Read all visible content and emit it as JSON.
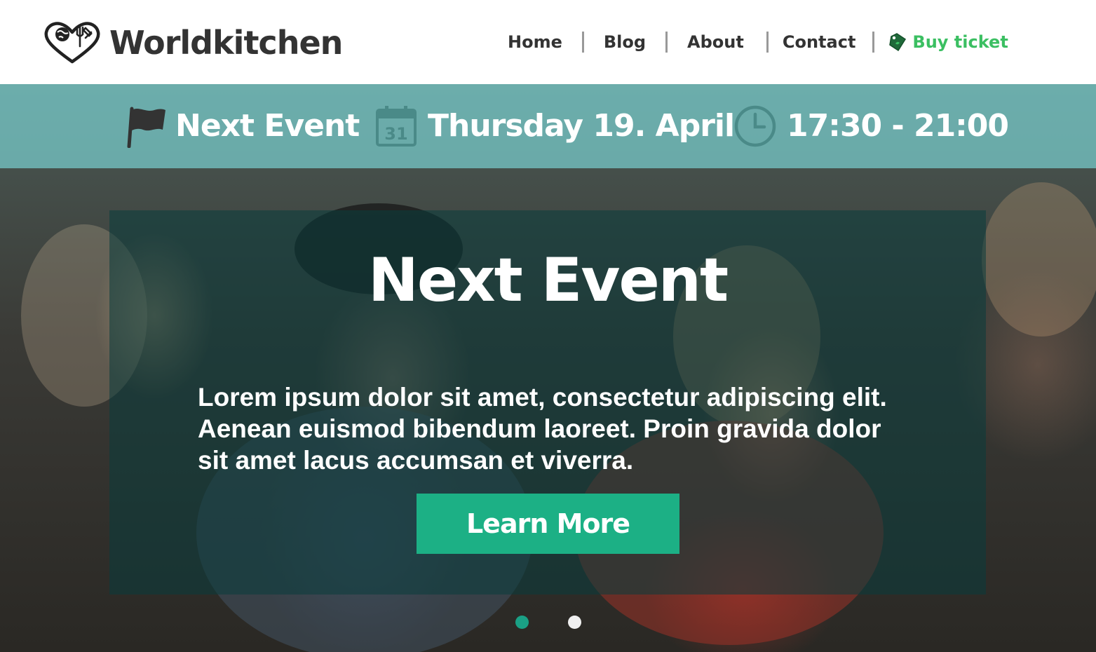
{
  "brand": {
    "name": "Worldkitchen"
  },
  "nav": {
    "items": [
      {
        "label": "Home"
      },
      {
        "label": "Blog"
      },
      {
        "label": "About"
      },
      {
        "label": "Contact"
      }
    ],
    "ticket_label": "Buy ticket",
    "ticket_icon": "ticket-tag-icon"
  },
  "event_bar": {
    "label": "Next Event",
    "date": "Thursday 19. April",
    "calendar_day": "31",
    "time": "17:30 - 21:00",
    "icons": [
      "flag-icon",
      "calendar-icon",
      "clock-icon"
    ]
  },
  "hero": {
    "title": "Next Event",
    "body": "Lorem ipsum dolor sit amet, consectetur adipiscing elit. Aenean euismod bibendum laoreet. Proin gravida dolor sit amet lacus accumsan et viverra.",
    "cta_label": "Learn More"
  },
  "slider": {
    "count": 2,
    "active": 1
  },
  "colors": {
    "accent_green": "#3bbf62",
    "cta": "#1cb085",
    "event_bar": "#78cdcd",
    "active_dot": "#1aa085",
    "inactive_dot": "#f0f0f0"
  }
}
